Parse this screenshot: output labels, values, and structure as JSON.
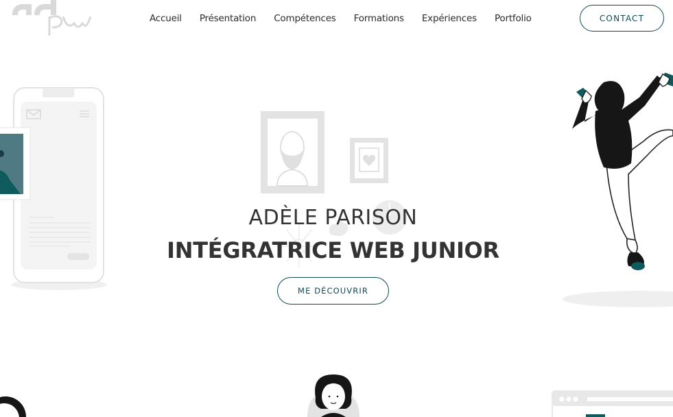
{
  "brand": {
    "logo_name": "adpw logo"
  },
  "nav": {
    "items": [
      {
        "label": "Accueil"
      },
      {
        "label": "Présentation"
      },
      {
        "label": "Compétences"
      },
      {
        "label": "Formations"
      },
      {
        "label": "Expériences"
      },
      {
        "label": "Portfolio"
      }
    ]
  },
  "header": {
    "contact_label": "CONTACT"
  },
  "hero": {
    "name": "ADÈLE PARISON",
    "title": "INTÉGRATRICE WEB JUNIOR",
    "cta_label": "ME DÉCOUVRIR"
  },
  "colors": {
    "accent": "#0e4a55",
    "teal": "#1e5d63",
    "text": "#333333",
    "illustration_gray": "#e8e8e8"
  },
  "icons": [
    "mail-icon",
    "menu-icon",
    "portrait-frame-icon",
    "heart-frame-icon",
    "clock-icon"
  ]
}
